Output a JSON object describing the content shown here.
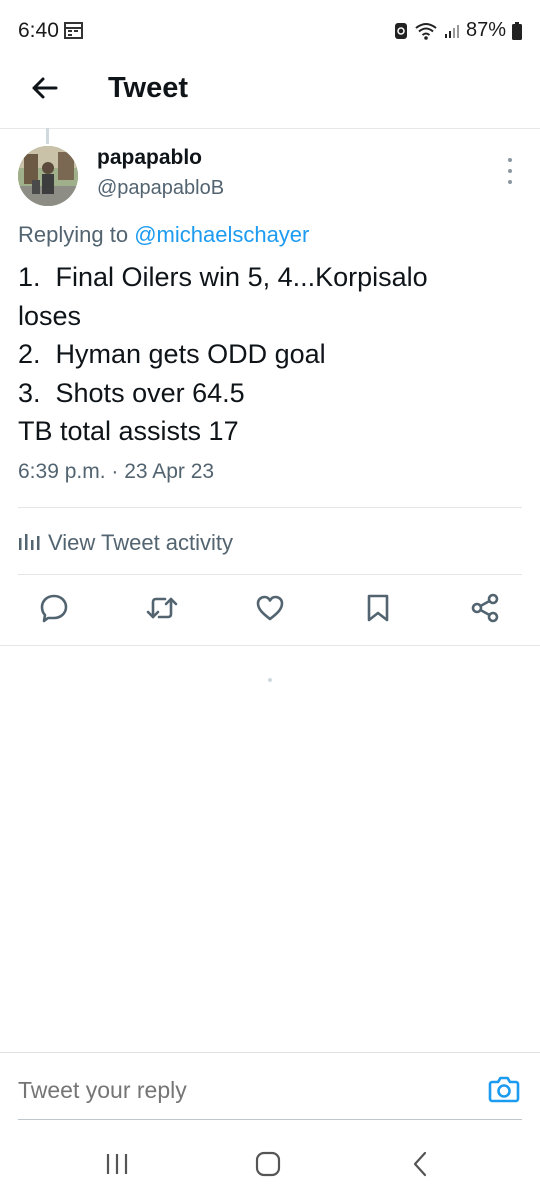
{
  "status_bar": {
    "time": "6:40",
    "battery": "87%"
  },
  "header": {
    "title": "Tweet"
  },
  "tweet": {
    "author_name": "papapablo",
    "author_handle": "@papapabloB",
    "replying_prefix": "Replying to ",
    "replying_to": "@michaelschayer",
    "lines": [
      "1.  Final Oilers win 5, 4...Korpisalo",
      "loses",
      "2.  Hyman gets ODD goal",
      "3.  Shots over 64.5",
      "TB total assists 17"
    ],
    "timestamp": "6:39 p.m. · 23 Apr 23"
  },
  "activity": {
    "label": "View Tweet activity"
  },
  "actions": {
    "icons": [
      "reply-icon",
      "retweet-icon",
      "like-icon",
      "bookmark-icon",
      "share-icon"
    ]
  },
  "reply_bar": {
    "placeholder": "Tweet your reply"
  },
  "colors": {
    "accent": "#1d9bf0",
    "text_primary": "#0f1419",
    "text_secondary": "#536471",
    "icon": "#536471"
  }
}
